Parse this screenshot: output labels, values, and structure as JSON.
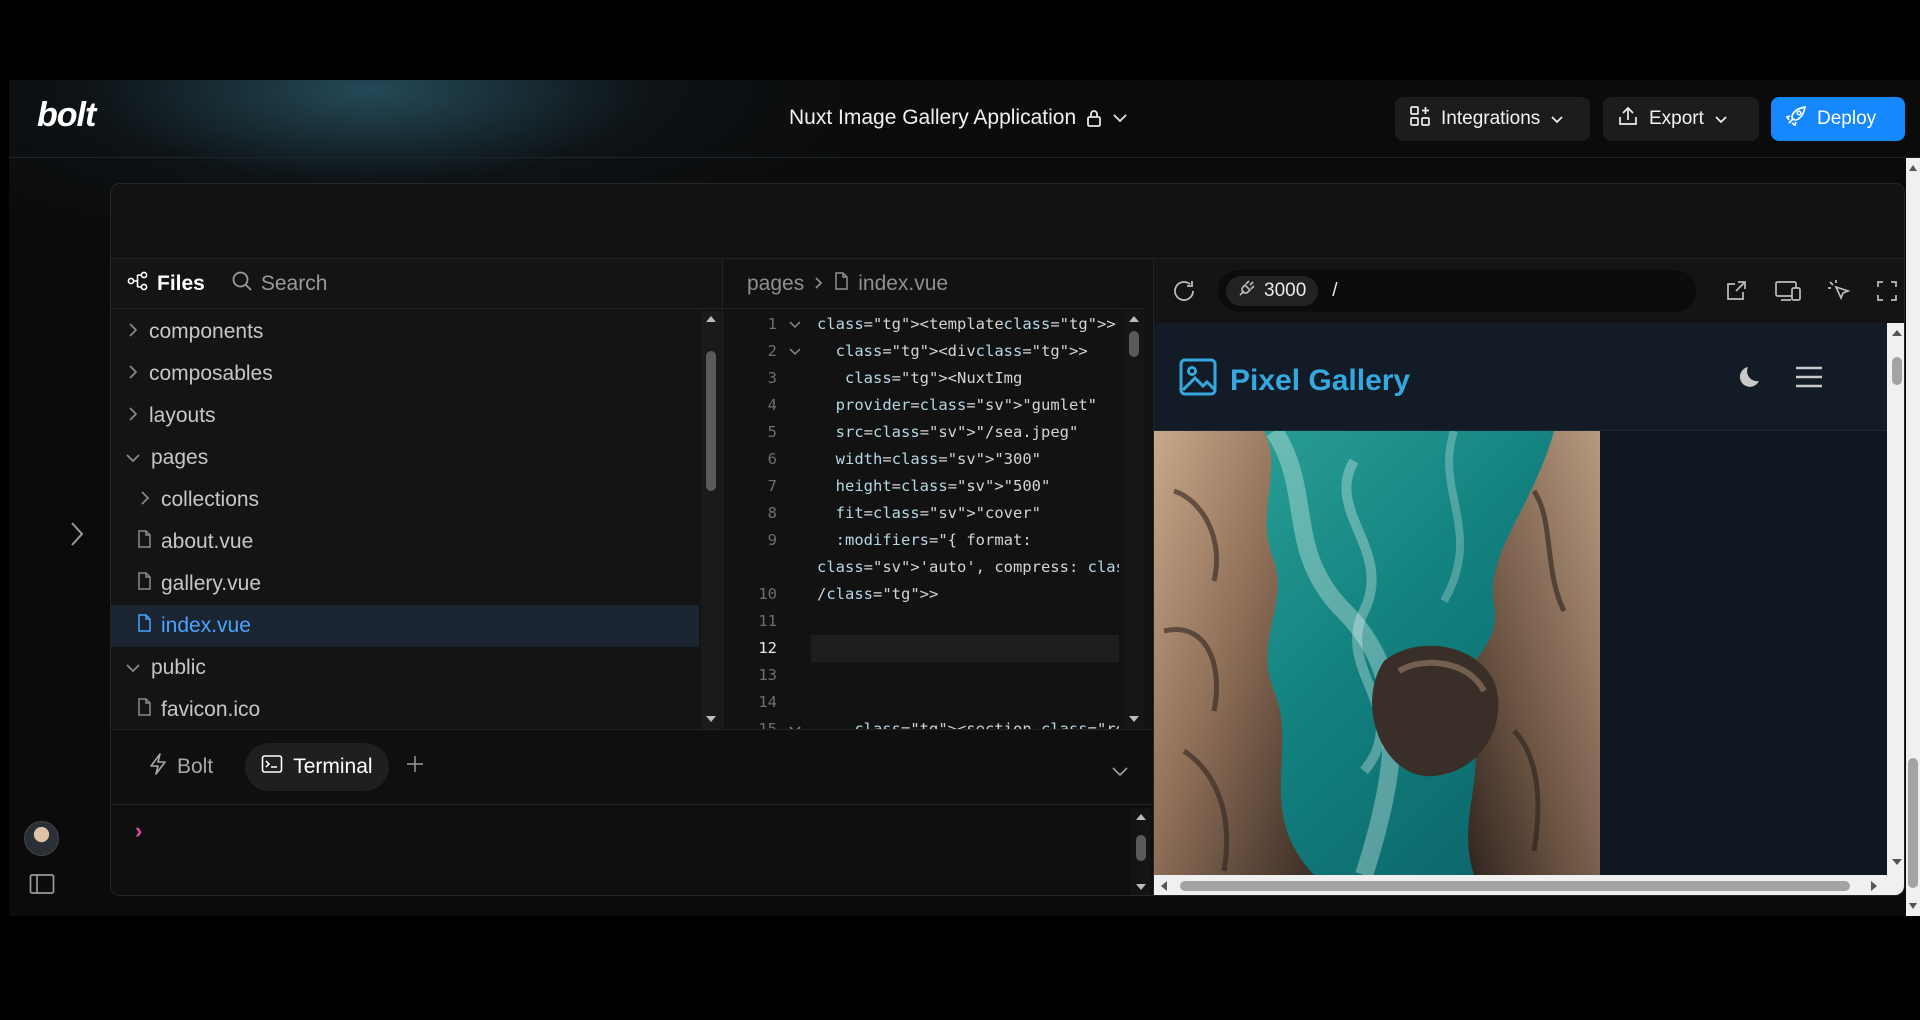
{
  "header": {
    "logo": "bolt",
    "project_title": "Nuxt Image Gallery Application",
    "integrations_label": "Integrations",
    "export_label": "Export",
    "deploy_label": "Deploy"
  },
  "file_panel": {
    "tabs": [
      {
        "label": "Files",
        "icon": "tree-icon"
      },
      {
        "label": "Search",
        "icon": "search-icon"
      }
    ],
    "tree": [
      {
        "label": "components",
        "type": "folder",
        "expanded": false,
        "depth": 0
      },
      {
        "label": "composables",
        "type": "folder",
        "expanded": false,
        "depth": 0
      },
      {
        "label": "layouts",
        "type": "folder",
        "expanded": false,
        "depth": 0
      },
      {
        "label": "pages",
        "type": "folder",
        "expanded": true,
        "depth": 0
      },
      {
        "label": "collections",
        "type": "folder",
        "expanded": false,
        "depth": 1
      },
      {
        "label": "about.vue",
        "type": "file",
        "depth": 1
      },
      {
        "label": "gallery.vue",
        "type": "file",
        "depth": 1
      },
      {
        "label": "index.vue",
        "type": "file",
        "depth": 1,
        "selected": true
      },
      {
        "label": "public",
        "type": "folder",
        "expanded": true,
        "depth": 0
      },
      {
        "label": "favicon.ico",
        "type": "file",
        "depth": 1
      }
    ]
  },
  "editor": {
    "breadcrumb": [
      "pages",
      "index.vue"
    ],
    "current_line": 12,
    "lines": [
      {
        "n": "1",
        "fold": true,
        "code": "<template>"
      },
      {
        "n": "2",
        "fold": true,
        "code": "  <div>"
      },
      {
        "n": "3",
        "fold": false,
        "code": "   <NuxtImg"
      },
      {
        "n": "4",
        "fold": false,
        "code": "  provider=\"gumlet\""
      },
      {
        "n": "5",
        "fold": false,
        "code": "  src=\"/sea.jpeg\""
      },
      {
        "n": "6",
        "fold": false,
        "code": "  width=\"300\""
      },
      {
        "n": "7",
        "fold": false,
        "code": "  height=\"500\""
      },
      {
        "n": "8",
        "fold": false,
        "code": "  fit=\"cover\""
      },
      {
        "n": "9",
        "fold": false,
        "code": "  :modifiers=\"{ format:"
      },
      {
        "n": "",
        "fold": false,
        "code": "'auto', compress: 'true' }\""
      },
      {
        "n": "10",
        "fold": false,
        "code": "/>"
      },
      {
        "n": "11",
        "fold": false,
        "code": ""
      },
      {
        "n": "12",
        "fold": false,
        "code": ""
      },
      {
        "n": "13",
        "fold": false,
        "code": ""
      },
      {
        "n": "14",
        "fold": false,
        "code": ""
      },
      {
        "n": "15",
        "fold": true,
        "code": "    <section class=\"relative"
      }
    ]
  },
  "preview": {
    "port": "3000",
    "path": "/",
    "site_title": "Pixel Gallery"
  },
  "terminal": {
    "tabs": [
      {
        "label": "Bolt",
        "icon": "bolt-icon"
      },
      {
        "label": "Terminal",
        "icon": "terminal-icon",
        "active": true
      }
    ],
    "prompt": "›"
  },
  "colors": {
    "accent": "#1488fc",
    "selection_text": "#4aa3ff",
    "brand": "#35a8e0",
    "prompt": "#e04aa5"
  }
}
